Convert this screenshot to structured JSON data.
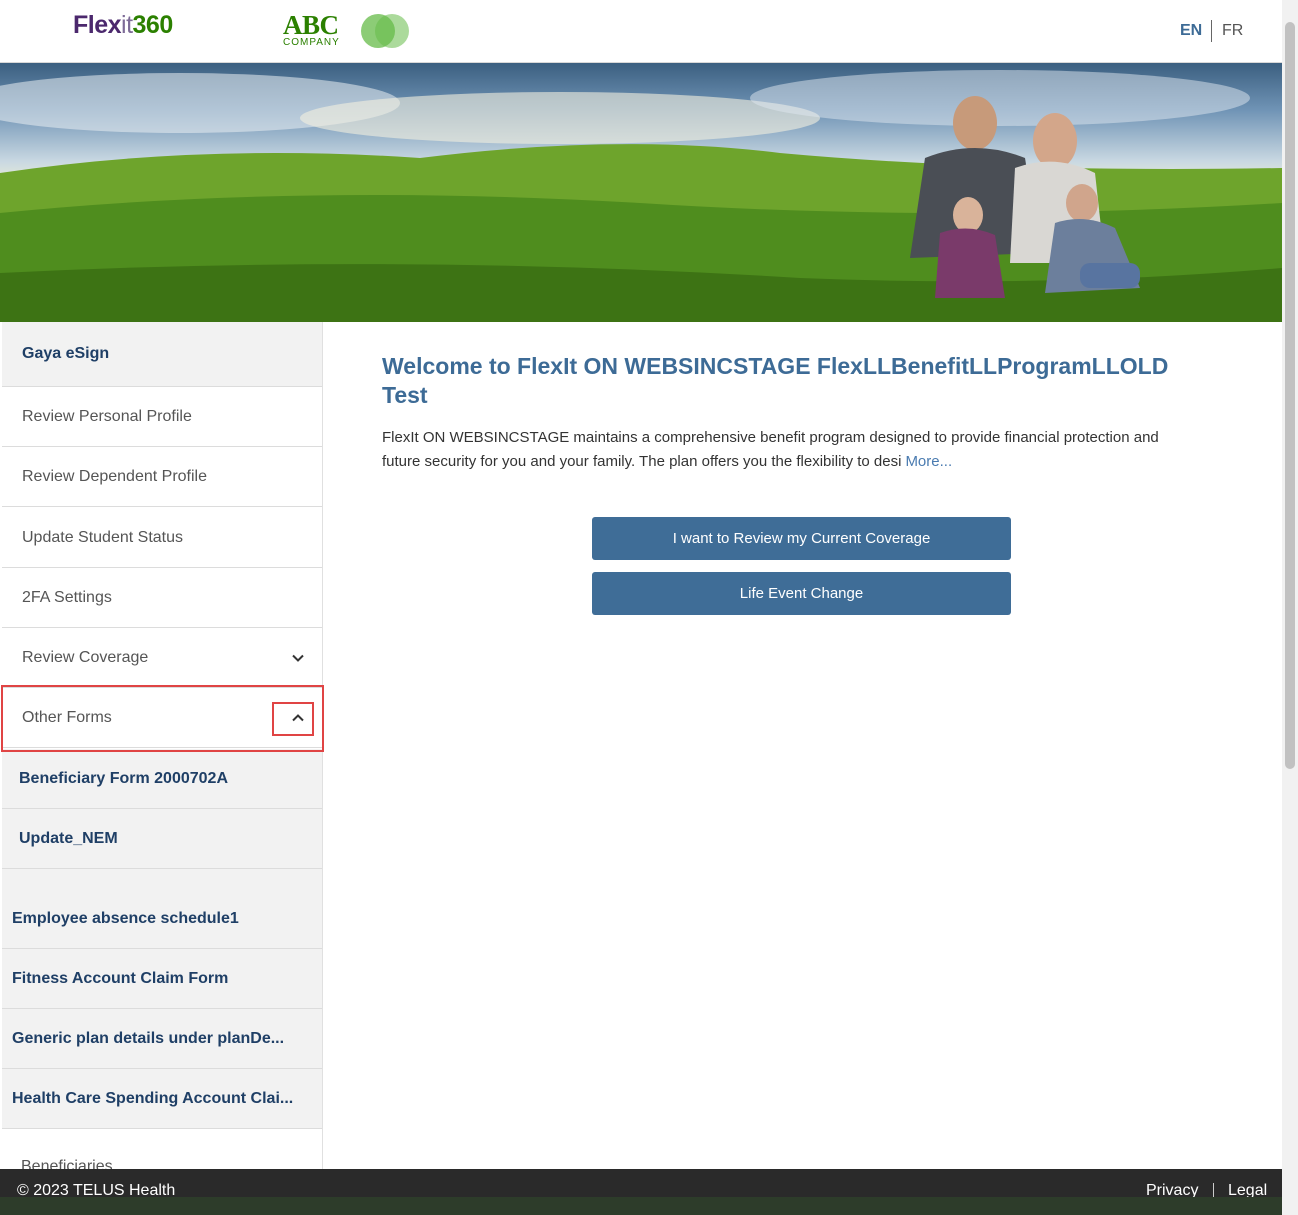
{
  "header": {
    "logo_flexit": {
      "part1": "Flex",
      "part2": "it",
      "part3": "360"
    },
    "logo_company": {
      "main": "ABC",
      "sub": "COMPANY"
    },
    "lang_en": "EN",
    "lang_fr": "FR"
  },
  "sidebar": {
    "items": [
      {
        "label": "Gaya eSign"
      },
      {
        "label": "Review Personal Profile"
      },
      {
        "label": "Review Dependent Profile"
      },
      {
        "label": "Update Student Status"
      },
      {
        "label": "2FA Settings"
      },
      {
        "label": "Review Coverage"
      },
      {
        "label": "Other Forms"
      },
      {
        "label": "Beneficiary Form 2000702A"
      },
      {
        "label": "Update_NEM"
      },
      {
        "label": "Employee absence schedule1"
      },
      {
        "label": "Fitness Account Claim Form"
      },
      {
        "label": "Generic plan details under planDe..."
      },
      {
        "label": "Health Care Spending Account Clai..."
      },
      {
        "label": "Beneficiaries"
      }
    ]
  },
  "main": {
    "welcome": "Welcome to FlexIt ON WEBSINCSTAGE FlexLLBenefitLLProgramLLOLD Test",
    "intro": "FlexIt ON WEBSINCSTAGE maintains a comprehensive benefit program designed to provide financial protection and future security for you and your family.  The plan offers you the flexibility to desi",
    "more_link": "More...",
    "btn_review": "I want to Review my Current Coverage",
    "btn_life_event": "Life Event Change"
  },
  "footer": {
    "copyright": "© 2023 TELUS Health",
    "privacy": "Privacy",
    "legal": "Legal"
  },
  "colors": {
    "accent": "#3f6d97",
    "heading": "#3d6b96",
    "highlight": "#e04444"
  }
}
